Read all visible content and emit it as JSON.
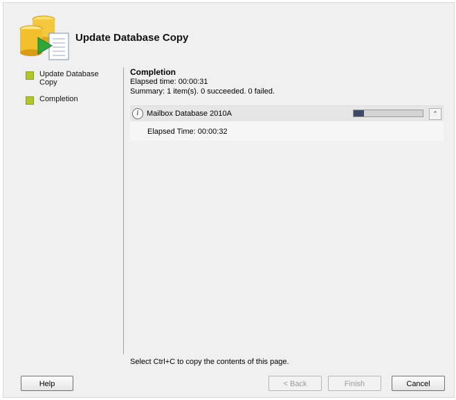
{
  "window": {
    "title": "Update Database Copy"
  },
  "nav": {
    "items": [
      {
        "label": "Update Database Copy"
      },
      {
        "label": "Completion"
      }
    ]
  },
  "content": {
    "section_title": "Completion",
    "elapsed_time": "Elapsed time: 00:00:31",
    "summary": "Summary: 1 item(s). 0 succeeded. 0 failed.",
    "task": {
      "name": "Mailbox Database 2010A",
      "progress": 0.15,
      "status_icon": "info-icon",
      "collapse_icon": "double-chevron-up-icon",
      "detail": "Elapsed Time: 00:00:32"
    },
    "copy_hint": "Select Ctrl+C to copy the contents of this page."
  },
  "buttons": {
    "help": "Help",
    "back": "< Back",
    "finish": "Finish",
    "cancel": "Cancel"
  },
  "colors": {
    "nav_bullet": "#b4c42c",
    "progress_fill": "#3c4a68"
  }
}
